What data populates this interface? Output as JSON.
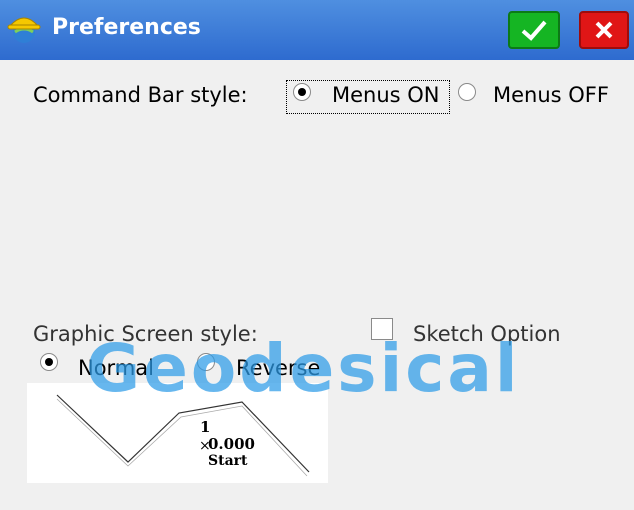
{
  "window": {
    "title": "Preferences",
    "app_icon": "hardhat-globe-icon",
    "ok_icon": "check-icon",
    "close_icon": "close-icon"
  },
  "command_bar": {
    "label": "Command Bar style:",
    "options": [
      {
        "label": "Menus ON",
        "selected": true
      },
      {
        "label": "Menus OFF",
        "selected": false
      }
    ]
  },
  "graphic_screen": {
    "label": "Graphic Screen style:",
    "options": [
      {
        "label": "Normal",
        "selected": true
      },
      {
        "label": "Reverse",
        "selected": false
      }
    ],
    "sketch_option": {
      "label": "Sketch Option",
      "checked": false
    }
  },
  "preview": {
    "point_number": "1",
    "coordinate": "0.000",
    "start_label": "Start"
  },
  "watermark": "Geodesical",
  "colors": {
    "titlebar": "#2e6bcf",
    "ok_button": "#15b523",
    "close_button": "#e01616",
    "watermark": "#2d9be8"
  }
}
